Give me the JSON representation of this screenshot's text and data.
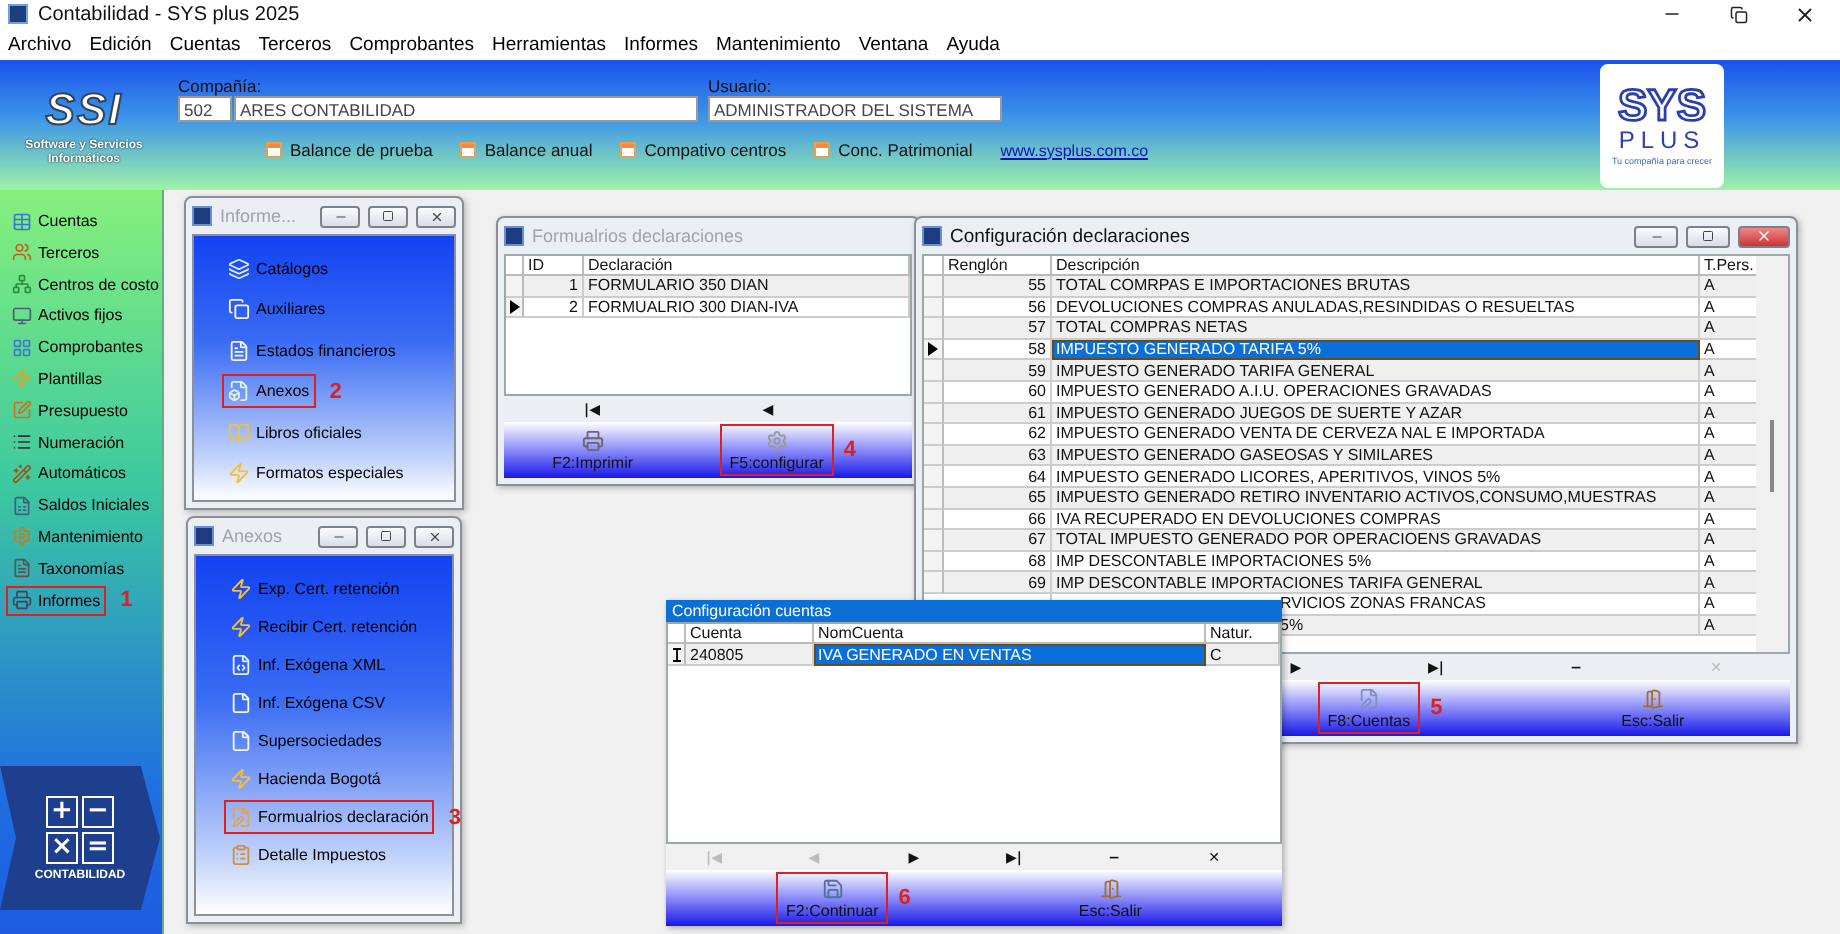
{
  "window": {
    "title": "Contabilidad - SYS plus 2025"
  },
  "menu": [
    "Archivo",
    "Edición",
    "Cuentas",
    "Terceros",
    "Comprobantes",
    "Herramientas",
    "Informes",
    "Mantenimiento",
    "Ventana",
    "Ayuda"
  ],
  "header": {
    "logo": {
      "letters": "SSI",
      "tagline": "Software y Servicios Informáticos"
    },
    "company_label": "Compañía:",
    "company_code": "502",
    "company_name": "ARES CONTABILIDAD",
    "user_label": "Usuario:",
    "user_name": "ADMINISTRADOR DEL SISTEMA",
    "shortcuts": [
      "Balance de prueba",
      "Balance anual",
      "Compativo centros",
      "Conc. Patrimonial"
    ],
    "link": "www.sysplus.com.co",
    "brand": {
      "top": "SYS",
      "bottom": "PLUS",
      "slogan": "Tu compañía para crecer"
    }
  },
  "sidebar": {
    "items": [
      {
        "label": "Cuentas"
      },
      {
        "label": "Terceros"
      },
      {
        "label": "Centros de costo"
      },
      {
        "label": "Activos fijos"
      },
      {
        "label": "Comprobantes"
      },
      {
        "label": "Plantillas"
      },
      {
        "label": "Presupuesto"
      },
      {
        "label": "Numeración"
      },
      {
        "label": "Automáticos"
      },
      {
        "label": "Saldos Iniciales"
      },
      {
        "label": "Mantenimiento"
      },
      {
        "label": "Taxonomías"
      },
      {
        "label": "Informes",
        "callout": "1"
      }
    ],
    "tile": {
      "keys": [
        "+",
        "−",
        "×",
        "="
      ],
      "label": "CONTABILIDAD"
    }
  },
  "informes_window": {
    "title": "Informe...",
    "active": false,
    "items": [
      {
        "label": "Catálogos"
      },
      {
        "label": "Auxiliares"
      },
      {
        "label": "Estados financieros"
      },
      {
        "label": "Anexos",
        "callout": "2"
      },
      {
        "label": "Libros oficiales"
      },
      {
        "label": "Formatos especiales"
      }
    ]
  },
  "anexos_window": {
    "title": "Anexos",
    "active": false,
    "items": [
      {
        "label": "Exp. Cert. retención"
      },
      {
        "label": "Recibir Cert. retención"
      },
      {
        "label": "Inf. Exógena XML"
      },
      {
        "label": "Inf. Exógena CSV"
      },
      {
        "label": "Supersociedades"
      },
      {
        "label": "Hacienda Bogotá"
      },
      {
        "label": "Formualrios declaración",
        "callout": "3"
      },
      {
        "label": "Detalle Impuestos"
      }
    ]
  },
  "formularios_window": {
    "title": "Formualrios declaraciones",
    "active": false,
    "columns": [
      "ID",
      "Declaración"
    ],
    "rows": [
      {
        "id": "1",
        "name": "FORMULARIO 350 DIAN",
        "selected": false
      },
      {
        "id": "2",
        "name": "FORMUALRIO 300 DIAN-IVA",
        "selected": true
      }
    ],
    "nav": [
      {
        "symbol": "|◀",
        "disabled": false
      },
      {
        "symbol": "◀",
        "disabled": false
      }
    ],
    "buttons": [
      {
        "label": "F2:Imprimir",
        "kind": "print"
      },
      {
        "label": "F5:configurar",
        "kind": "configure",
        "callout": "4"
      }
    ]
  },
  "declaraciones_window": {
    "title": "Configuración declaraciones",
    "active": true,
    "columns": [
      "Renglón",
      "Descripción",
      "T.Pers."
    ],
    "rows": [
      {
        "kind": "full",
        "renglon": "55",
        "descripcion": "TOTAL COMRPAS E IMPORTACIONES BRUTAS",
        "t_pers": "A",
        "selected": false
      },
      {
        "kind": "full",
        "renglon": "56",
        "descripcion": "DEVOLUCIONES COMPRAS ANULADAS,RESINDIDAS O RESUELTAS",
        "t_pers": "A",
        "selected": false
      },
      {
        "kind": "full",
        "renglon": "57",
        "descripcion": "TOTAL COMPRAS NETAS",
        "t_pers": "A",
        "selected": false
      },
      {
        "kind": "full",
        "renglon": "58",
        "descripcion": "IMPUESTO GENERADO TARIFA 5%",
        "t_pers": "A",
        "selected": true
      },
      {
        "kind": "full",
        "renglon": "59",
        "descripcion": "IMPUESTO GENERADO TARIFA GENERAL",
        "t_pers": "A",
        "selected": false
      },
      {
        "kind": "full",
        "renglon": "60",
        "descripcion": "IMPUESTO GENERADO A.I.U. OPERACIONES GRAVADAS",
        "t_pers": "A",
        "selected": false
      },
      {
        "kind": "full",
        "renglon": "61",
        "descripcion": "IMPUESTO GENERADO JUEGOS DE SUERTE Y AZAR",
        "t_pers": "A",
        "selected": false
      },
      {
        "kind": "full",
        "renglon": "62",
        "descripcion": "IMPUESTO GENERADO VENTA DE CERVEZA NAL E IMPORTADA",
        "t_pers": "A",
        "selected": false
      },
      {
        "kind": "full",
        "renglon": "63",
        "descripcion": "IMPUESTO GENERADO GASEOSAS Y SIMILARES",
        "t_pers": "A",
        "selected": false
      },
      {
        "kind": "full",
        "renglon": "64",
        "descripcion": "IMPUESTO GENERADO LICORES, APERITIVOS, VINOS 5%",
        "t_pers": "A",
        "selected": false
      },
      {
        "kind": "full",
        "renglon": "65",
        "descripcion": "IMPUESTO GENERADO RETIRO INVENTARIO ACTIVOS,CONSUMO,MUESTRAS",
        "t_pers": "A",
        "selected": false
      },
      {
        "kind": "full",
        "renglon": "66",
        "descripcion": "IVA RECUPERADO EN DEVOLUCIONES COMPRAS",
        "t_pers": "A",
        "selected": false
      },
      {
        "kind": "full",
        "renglon": "67",
        "descripcion": "TOTAL IMPUESTO GENERADO POR OPERACIOENS GRAVADAS",
        "t_pers": "A",
        "selected": false
      },
      {
        "kind": "full",
        "renglon": "68",
        "descripcion": "IMP DESCONTABLE IMPORTACIONES 5%",
        "t_pers": "A",
        "selected": false
      },
      {
        "kind": "full",
        "renglon": "69",
        "descripcion": "IMP DESCONTABLE IMPORTACIONES TARIFA GENERAL",
        "t_pers": "A",
        "selected": false
      },
      {
        "kind": "partial",
        "descripcion": "RVICIOS ZONAS FRANCAS",
        "t_pers": "A",
        "selected": false
      },
      {
        "kind": "partial",
        "descripcion": "5%",
        "t_pers": "A",
        "selected": false
      }
    ],
    "nav": [
      {
        "symbol": "▶",
        "disabled": false
      },
      {
        "symbol": "▶|",
        "disabled": false
      },
      {
        "symbol": "−",
        "disabled": false
      },
      {
        "symbol": "✕",
        "disabled": true
      }
    ],
    "buttons": [
      {
        "label": "F8:Cuentas",
        "kind": "accounts",
        "callout": "5"
      },
      {
        "label": "Esc:Salir",
        "kind": "exit"
      }
    ]
  },
  "cuentas_window": {
    "title": "Configuración cuentas",
    "columns": [
      "Cuenta",
      "NomCuenta",
      "Natur."
    ],
    "rows": [
      {
        "cuenta": "240805",
        "nombre": "IVA GENERADO EN VENTAS",
        "naturaleza": "C",
        "selected": true
      }
    ],
    "nav": [
      {
        "symbol": "|◀",
        "disabled": true
      },
      {
        "symbol": "◀",
        "disabled": true
      },
      {
        "symbol": "▶",
        "disabled": false
      },
      {
        "symbol": "▶|",
        "disabled": false
      },
      {
        "symbol": "−",
        "disabled": false
      },
      {
        "symbol": "✕",
        "disabled": false
      }
    ],
    "buttons": [
      {
        "label": "F2:Continuar",
        "kind": "save",
        "callout": "6"
      },
      {
        "label": "Esc:Salir",
        "kind": "exit"
      }
    ]
  }
}
